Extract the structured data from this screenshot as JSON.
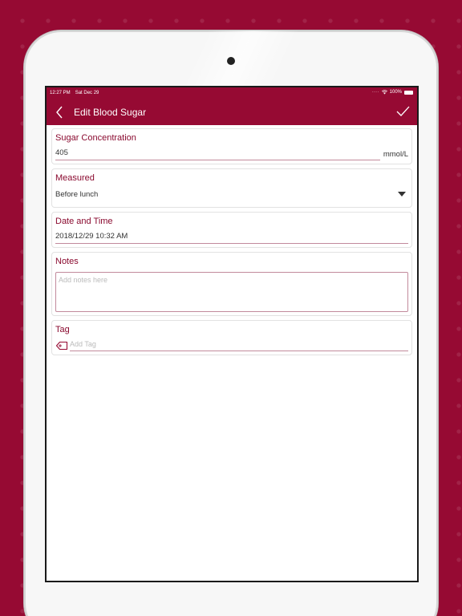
{
  "status_bar": {
    "time": "12:27 PM",
    "date": "Sat Dec 29",
    "signal_dots": "····",
    "battery_text": "100%"
  },
  "nav": {
    "title": "Edit Blood Sugar"
  },
  "form": {
    "sugar": {
      "label": "Sugar Concentration",
      "value": "405",
      "unit": "mmol/L"
    },
    "measured": {
      "label": "Measured",
      "value": "Before lunch"
    },
    "datetime": {
      "label": "Date and Time",
      "value": "2018/12/29 10:32 AM"
    },
    "notes": {
      "label": "Notes",
      "placeholder": "Add notes here"
    },
    "tag": {
      "label": "Tag",
      "placeholder": "Add Tag"
    }
  },
  "icons": {
    "back": "chevron-left-icon",
    "save": "checkmark-icon",
    "dropdown": "caret-down-icon",
    "tag": "tag-icon",
    "wifi": "wifi-icon",
    "battery": "battery-icon"
  },
  "colors": {
    "brand": "#960a33",
    "label": "#8a0a2f",
    "underline": "#c28a9c"
  }
}
